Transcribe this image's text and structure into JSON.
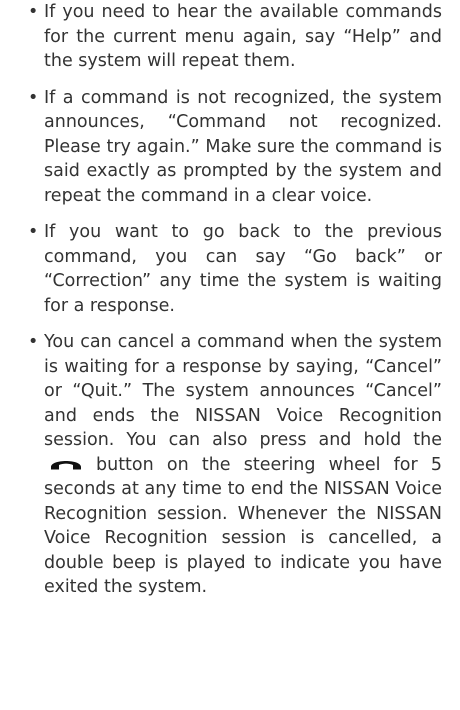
{
  "bullets": [
    {
      "marker": "•",
      "text": "If you need to hear the available com­mands for the current menu again, say “Help” and the system will repeat them."
    },
    {
      "marker": "•",
      "text": "If a command is not recognized, the system announces, “Command not recognized. Please try again.” Make sure the command is said exactly as prompted by the system and repeat the command in a clear voice."
    },
    {
      "marker": "•",
      "text": "If you want to go back to the previous command, you can say “Go back” or “Correction” any time the system is waiting for a response."
    },
    {
      "marker": "•",
      "text_before_icon": "You can cancel a command when the system is waiting for a response by say­ing, “Cancel” or “Quit.” The system an­nounces “Cancel” and ends the NISSAN Voice Recognition session. You can also press and hold the",
      "icon": "phone-hangup-icon",
      "text_after_icon": "button on the steering wheel for 5 seconds at any time to end the NISSAN Voice Recogni­tion session. Whenever the NISSAN Voice Recognition session is cancelled, a double beep is played to indicate you have exited the system."
    }
  ]
}
